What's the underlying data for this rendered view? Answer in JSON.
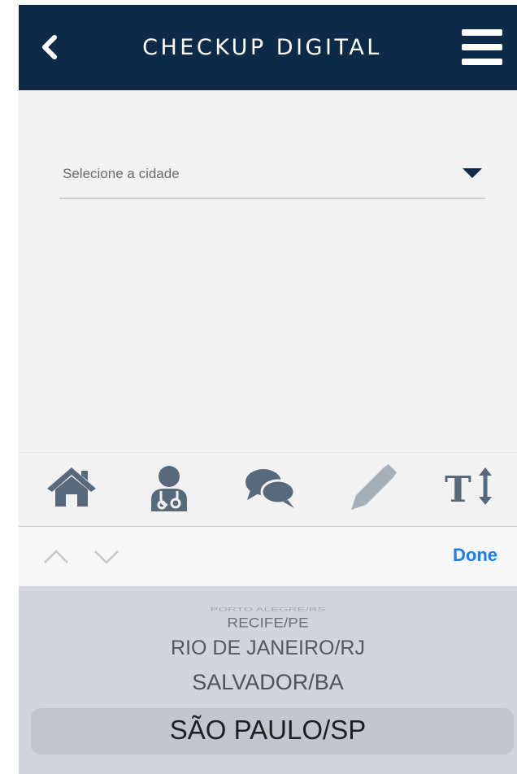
{
  "header": {
    "title": "CHECKUP DIGITAL",
    "back_icon": "chevron-left-icon",
    "menu_icon": "hamburger-menu-icon",
    "background": "#0e2a49"
  },
  "city_select": {
    "placeholder": "Selecione a cidade",
    "caret_icon": "caret-down-icon"
  },
  "toolbar": {
    "items": [
      {
        "icon": "home-icon"
      },
      {
        "icon": "doctor-icon"
      },
      {
        "icon": "chat-bubbles-icon"
      },
      {
        "icon": "pencil-icon"
      },
      {
        "icon": "text-size-icon",
        "label": "T"
      }
    ]
  },
  "keyboard_accessory": {
    "done_label": "Done",
    "accent": "#1a7cf2"
  },
  "picker": {
    "options": [
      "PORTO ALEGRE/RS",
      "RECIFE/PE",
      "RIO DE JANEIRO/RJ",
      "SALVADOR/BA",
      "SÃO PAULO/SP"
    ],
    "selected": "SÃO PAULO/SP"
  }
}
